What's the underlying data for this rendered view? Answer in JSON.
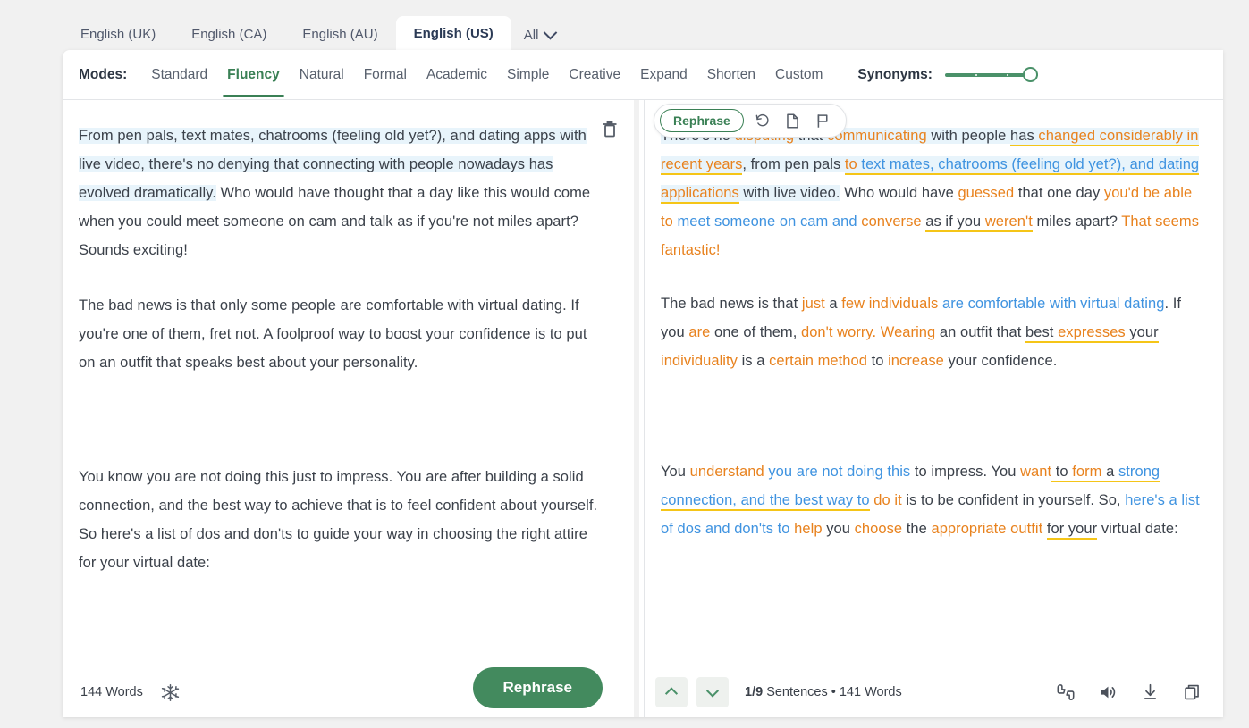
{
  "language_tabs": [
    {
      "label": "English (UK)",
      "active": false
    },
    {
      "label": "English (CA)",
      "active": false
    },
    {
      "label": "English (AU)",
      "active": false
    },
    {
      "label": "English (US)",
      "active": true
    }
  ],
  "language_all": "All",
  "modes": {
    "label": "Modes:",
    "items": [
      "Standard",
      "Fluency",
      "Natural",
      "Formal",
      "Academic",
      "Simple",
      "Creative",
      "Expand",
      "Shorten",
      "Custom"
    ],
    "active": "Fluency"
  },
  "synonyms": {
    "label": "Synonyms:",
    "value": 100
  },
  "float_toolbar": {
    "rephrase_label": "Rephrase",
    "icons": [
      "history-icon",
      "document-icon",
      "flag-icon"
    ]
  },
  "input_panel": {
    "delete_icon": "trash-icon",
    "paragraphs": [
      "From pen pals, text mates, chatrooms (feeling old yet?), and dating apps with live video, there's no denying that connecting with people nowadays has evolved dramatically. Who would have thought that a day like this would come when you could meet someone on cam and talk as if you're not miles apart? Sounds exciting!",
      "The bad news is that only some people are comfortable with virtual dating. If you're one of them, fret not. A foolproof way to boost your confidence is to put on an outfit that speaks best about your personality.",
      "You know you are not doing this just to impress. You are after building a solid connection, and the best way to achieve that is to feel confident about yourself. So here's a list of dos and don'ts to guide your way in choosing the right attire for your virtual date:"
    ],
    "highlighted_sentence": "From pen pals, text mates, chatrooms (feeling old yet?), and dating apps with live video, there's no denying that connecting with people nowadays has evolved dramatically.",
    "footer": {
      "word_count": "144 Words",
      "freeze_icon": "snowflake-icon",
      "rephrase_button": "Rephrase"
    }
  },
  "output_panel": {
    "paragraphs": [
      [
        {
          "t": "There's no ",
          "s": "plain",
          "hl": true
        },
        {
          "t": "disputing",
          "s": "chg",
          "hl": true
        },
        {
          "t": " that ",
          "s": "plain",
          "hl": true
        },
        {
          "t": "communicating",
          "s": "chg",
          "hl": true
        },
        {
          "t": " with people ",
          "s": "plain",
          "hl": true
        },
        {
          "t": "has ",
          "s": "plain",
          "hl": true,
          "u": true
        },
        {
          "t": "changed considerably",
          "s": "chg",
          "hl": true,
          "u": true
        },
        {
          "t": " in recent years",
          "s": "chg",
          "hl": true,
          "u": true
        },
        {
          "t": ",",
          "s": "plain",
          "hl": true
        },
        {
          "t": " from pen pals ",
          "s": "plain",
          "hl": true
        },
        {
          "t": "to",
          "s": "chg",
          "hl": true,
          "u": true
        },
        {
          "t": " text mates, chatrooms (feeling old yet?), and dating ",
          "s": "mov",
          "hl": true,
          "u": true
        },
        {
          "t": "applications",
          "s": "chg",
          "hl": true,
          "u": true
        },
        {
          "t": " with live video.",
          "s": "plain",
          "hl": true
        },
        {
          "t": " Who would have ",
          "s": "plain"
        },
        {
          "t": "guessed",
          "s": "chg"
        },
        {
          "t": " that one day ",
          "s": "plain"
        },
        {
          "t": "you'd be able to",
          "s": "chg"
        },
        {
          "t": " ",
          "s": "plain"
        },
        {
          "t": "meet someone on cam and",
          "s": "mov"
        },
        {
          "t": " ",
          "s": "plain"
        },
        {
          "t": "converse",
          "s": "chg"
        },
        {
          "t": " ",
          "s": "plain"
        },
        {
          "t": "as if you ",
          "s": "plain",
          "u": true
        },
        {
          "t": "weren't",
          "s": "chg",
          "u": true
        },
        {
          "t": " miles apart? ",
          "s": "plain"
        },
        {
          "t": "That seems fantastic!",
          "s": "chg"
        }
      ],
      [
        {
          "t": "The bad news is that ",
          "s": "plain"
        },
        {
          "t": "just",
          "s": "chg"
        },
        {
          "t": " a ",
          "s": "plain"
        },
        {
          "t": "few individuals",
          "s": "chg"
        },
        {
          "t": " ",
          "s": "plain"
        },
        {
          "t": "are comfortable with virtual dating",
          "s": "mov"
        },
        {
          "t": ". If you ",
          "s": "plain"
        },
        {
          "t": "are",
          "s": "chg"
        },
        {
          "t": " one of them, ",
          "s": "plain"
        },
        {
          "t": "don't worry. Wearing",
          "s": "chg"
        },
        {
          "t": " an outfit that ",
          "s": "plain"
        },
        {
          "t": "best ",
          "s": "plain",
          "u": true
        },
        {
          "t": "expresses",
          "s": "chg",
          "u": true
        },
        {
          "t": " your",
          "s": "plain",
          "u": true
        },
        {
          "t": " ",
          "s": "plain"
        },
        {
          "t": "individuality",
          "s": "chg"
        },
        {
          "t": " is a ",
          "s": "plain"
        },
        {
          "t": "certain method",
          "s": "chg"
        },
        {
          "t": " to ",
          "s": "plain"
        },
        {
          "t": "increase",
          "s": "chg"
        },
        {
          "t": " your confidence.",
          "s": "plain"
        }
      ],
      [
        {
          "t": "You ",
          "s": "plain"
        },
        {
          "t": "understand",
          "s": "chg"
        },
        {
          "t": " ",
          "s": "plain"
        },
        {
          "t": "you are not doing this",
          "s": "mov"
        },
        {
          "t": " to impress. You ",
          "s": "plain"
        },
        {
          "t": "want",
          "s": "chg"
        },
        {
          "t": " to ",
          "s": "plain",
          "u": true
        },
        {
          "t": "form",
          "s": "chg",
          "u": true
        },
        {
          "t": " a ",
          "s": "plain",
          "u": true
        },
        {
          "t": "strong connection, and the best way to",
          "s": "mov",
          "u": true
        },
        {
          "t": " ",
          "s": "plain"
        },
        {
          "t": "do it",
          "s": "chg"
        },
        {
          "t": " is to be confident in yourself. So, ",
          "s": "plain"
        },
        {
          "t": "here's a list of dos and don'ts to",
          "s": "mov"
        },
        {
          "t": " ",
          "s": "plain"
        },
        {
          "t": "help",
          "s": "chg"
        },
        {
          "t": " you ",
          "s": "plain"
        },
        {
          "t": "choose",
          "s": "chg"
        },
        {
          "t": " the ",
          "s": "plain"
        },
        {
          "t": "appropriate outfit",
          "s": "chg"
        },
        {
          "t": " ",
          "s": "plain"
        },
        {
          "t": "for your",
          "s": "plain",
          "u": true
        },
        {
          "t": " virtual date:",
          "s": "plain"
        }
      ]
    ],
    "footer": {
      "prev_icon": "chevron-up-icon",
      "next_icon": "chevron-down-icon",
      "sentence_position": "1/9",
      "sentence_label": " Sentences • 141 Words",
      "icons": [
        "thumbs-feedback-icon",
        "speaker-icon",
        "download-icon",
        "copy-icon"
      ]
    }
  },
  "colors": {
    "accent_green": "#438a5e",
    "changed_orange": "#e8821e",
    "moved_blue": "#3f93e0",
    "underline_yellow": "#f5c518",
    "highlight_blue": "#e8f4fb"
  }
}
